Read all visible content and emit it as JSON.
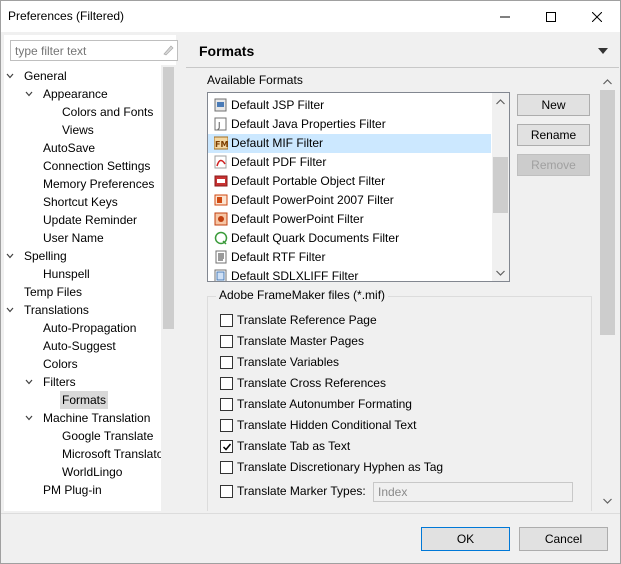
{
  "window": {
    "title": "Preferences (Filtered)"
  },
  "filter": {
    "placeholder": "type filter text"
  },
  "tree": [
    {
      "label": "General",
      "expanded": true
    },
    {
      "label": "Appearance",
      "expanded": true
    },
    {
      "label": "Colors and Fonts"
    },
    {
      "label": "Views"
    },
    {
      "label": "AutoSave"
    },
    {
      "label": "Connection Settings"
    },
    {
      "label": "Memory Preferences"
    },
    {
      "label": "Shortcut Keys"
    },
    {
      "label": "Update Reminder"
    },
    {
      "label": "User Name"
    },
    {
      "label": "Spelling",
      "expanded": true
    },
    {
      "label": "Hunspell"
    },
    {
      "label": "Temp Files"
    },
    {
      "label": "Translations",
      "expanded": true
    },
    {
      "label": "Auto-Propagation"
    },
    {
      "label": "Auto-Suggest"
    },
    {
      "label": "Colors"
    },
    {
      "label": "Filters",
      "expanded": true
    },
    {
      "label": "Formats",
      "selected": true
    },
    {
      "label": "Machine Translation",
      "expanded": true
    },
    {
      "label": "Google Translate"
    },
    {
      "label": "Microsoft Translator"
    },
    {
      "label": "WorldLingo"
    },
    {
      "label": "PM Plug-in"
    }
  ],
  "page": {
    "title": "Formats",
    "available_label": "Available Formats",
    "formats": [
      {
        "label": "Default JSP Filter",
        "icon": "jsp-icon"
      },
      {
        "label": "Default Java Properties Filter",
        "icon": "java-properties-icon"
      },
      {
        "label": "Default MIF Filter",
        "icon": "framemaker-icon",
        "selected": true
      },
      {
        "label": "Default PDF Filter",
        "icon": "pdf-icon"
      },
      {
        "label": "Default Portable Object Filter",
        "icon": "po-icon"
      },
      {
        "label": "Default PowerPoint 2007 Filter",
        "icon": "powerpoint-2007-icon"
      },
      {
        "label": "Default PowerPoint Filter",
        "icon": "powerpoint-icon"
      },
      {
        "label": "Default Quark Documents Filter",
        "icon": "quark-icon"
      },
      {
        "label": "Default RTF Filter",
        "icon": "rtf-icon"
      },
      {
        "label": "Default SDLXLIFF Filter",
        "icon": "sdlxliff-icon"
      }
    ],
    "buttons": {
      "new": "New",
      "rename": "Rename",
      "remove": "Remove"
    },
    "group": {
      "title": "Adobe FrameMaker files (*.mif)",
      "options": [
        {
          "label": "Translate Reference Page",
          "checked": false
        },
        {
          "label": "Translate Master Pages",
          "checked": false
        },
        {
          "label": "Translate Variables",
          "checked": false
        },
        {
          "label": "Translate Cross References",
          "checked": false
        },
        {
          "label": "Translate Autonumber Formating",
          "checked": false
        },
        {
          "label": "Translate Hidden Conditional Text",
          "checked": false
        },
        {
          "label": "Translate Tab as Text",
          "checked": true
        },
        {
          "label": "Translate Discretionary Hyphen as Tag",
          "checked": false
        },
        {
          "label": "Translate Marker Types:",
          "checked": false
        }
      ],
      "marker_types_value": "Index"
    }
  },
  "footer": {
    "ok": "OK",
    "cancel": "Cancel"
  }
}
